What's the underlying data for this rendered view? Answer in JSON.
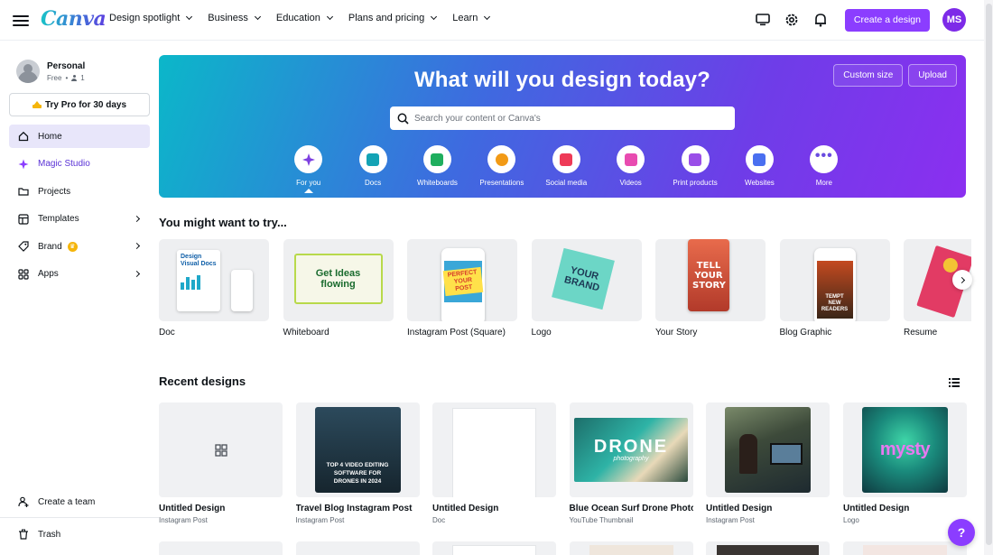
{
  "brand": {
    "logo_text": "Canva",
    "accent": "#8b3dff"
  },
  "nav": [
    {
      "label": "Design spotlight"
    },
    {
      "label": "Business"
    },
    {
      "label": "Education"
    },
    {
      "label": "Plans and pricing"
    },
    {
      "label": "Learn"
    }
  ],
  "header": {
    "icons": [
      "desktop-icon",
      "gear-icon",
      "bell-icon"
    ],
    "create_label": "Create a design",
    "avatar_initials": "MS"
  },
  "sidebar": {
    "profile_name": "Personal",
    "plan": "Free",
    "member_count": "1",
    "try_pro_label": "Try Pro for 30 days",
    "items": [
      {
        "label": "Home",
        "icon": "home-icon"
      },
      {
        "label": "Magic Studio",
        "icon": "sparkle-icon"
      },
      {
        "label": "Projects",
        "icon": "folder-icon"
      },
      {
        "label": "Templates",
        "icon": "layout-icon"
      },
      {
        "label": "Brand",
        "icon": "brand-icon"
      },
      {
        "label": "Apps",
        "icon": "apps-icon"
      }
    ],
    "create_team_label": "Create a team",
    "trash_label": "Trash"
  },
  "hero": {
    "title": "What will you design today?",
    "custom_size_label": "Custom size",
    "upload_label": "Upload",
    "search_placeholder": "Search your content or Canva's",
    "categories": [
      {
        "label": "For you",
        "color": "#7d3fe0"
      },
      {
        "label": "Docs",
        "color": "#13a3b5"
      },
      {
        "label": "Whiteboards",
        "color": "#1fae5e"
      },
      {
        "label": "Presentations",
        "color": "#f29a16"
      },
      {
        "label": "Social media",
        "color": "#ee3a57"
      },
      {
        "label": "Videos",
        "color": "#e84bb0"
      },
      {
        "label": "Print products",
        "color": "#9a4ee8"
      },
      {
        "label": "Websites",
        "color": "#4a6ff0"
      },
      {
        "label": "More",
        "color": "#6a4ce0"
      }
    ]
  },
  "suggestions": {
    "title": "You might want to try...",
    "items": [
      {
        "label": "Doc",
        "thumb_text": "Design Visual Docs"
      },
      {
        "label": "Whiteboard",
        "thumb_text": "Get Ideas flowing"
      },
      {
        "label": "Instagram Post (Square)",
        "thumb_text": "PERFECT YOUR POST"
      },
      {
        "label": "Logo",
        "thumb_text": "YOUR BRAND"
      },
      {
        "label": "Your Story",
        "thumb_text": "TELL YOUR STORY"
      },
      {
        "label": "Blog Graphic",
        "thumb_text": "TEMPT NEW READERS"
      },
      {
        "label": "Resume",
        "thumb_text": ""
      }
    ]
  },
  "recent": {
    "title": "Recent designs",
    "items": [
      {
        "name": "Untitled Design",
        "type": "Instagram Post",
        "thumb_text": ""
      },
      {
        "name": "Travel Blog Instagram Post",
        "type": "Instagram Post",
        "thumb_text": "TOP 4 VIDEO EDITING SOFTWARE FOR DRONES IN 2024"
      },
      {
        "name": "Untitled Design",
        "type": "Doc",
        "thumb_text": ""
      },
      {
        "name": "Blue Ocean Surf Drone Photography",
        "type": "YouTube Thumbnail",
        "thumb_text": "DRONE",
        "thumb_sub": "photography"
      },
      {
        "name": "Untitled Design",
        "type": "Instagram Post",
        "thumb_text": ""
      },
      {
        "name": "Untitled Design",
        "type": "Logo",
        "thumb_text": "mysty"
      }
    ]
  },
  "help_label": "?"
}
